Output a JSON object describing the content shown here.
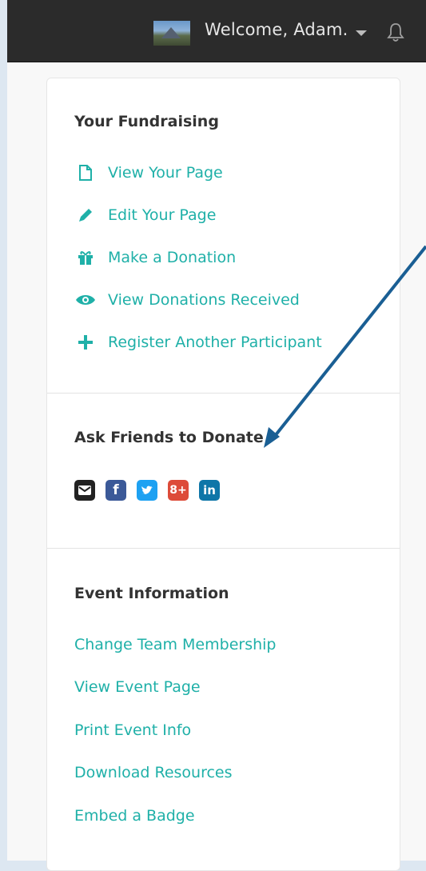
{
  "header": {
    "welcome_text": "Welcome, Adam."
  },
  "fundraising": {
    "title": "Your Fundraising",
    "links": [
      {
        "label": "View Your Page",
        "icon": "file-icon"
      },
      {
        "label": "Edit Your Page",
        "icon": "pencil-icon"
      },
      {
        "label": "Make a Donation",
        "icon": "gift-icon"
      },
      {
        "label": "View Donations Received",
        "icon": "eye-icon"
      },
      {
        "label": "Register Another Participant",
        "icon": "plus-icon"
      }
    ]
  },
  "ask_friends": {
    "title": "Ask Friends to Donate",
    "buttons": [
      {
        "name": "email",
        "glyph": "",
        "color": "#222222"
      },
      {
        "name": "facebook",
        "glyph": "f",
        "color": "#3b5998"
      },
      {
        "name": "twitter",
        "glyph": "",
        "color": "#1da1f2"
      },
      {
        "name": "google-plus",
        "glyph": "8+",
        "color": "#dd4b39"
      },
      {
        "name": "linkedin",
        "glyph": "in",
        "color": "#0e76a8"
      }
    ]
  },
  "event_info": {
    "title": "Event Information",
    "links": [
      {
        "label": "Change Team Membership"
      },
      {
        "label": "View Event Page"
      },
      {
        "label": "Print Event Info"
      },
      {
        "label": "Download Resources"
      },
      {
        "label": "Embed a Badge"
      }
    ]
  },
  "colors": {
    "accent": "#1fb0a8",
    "topbar": "#2b2b2b",
    "arrow": "#1a5f94"
  }
}
